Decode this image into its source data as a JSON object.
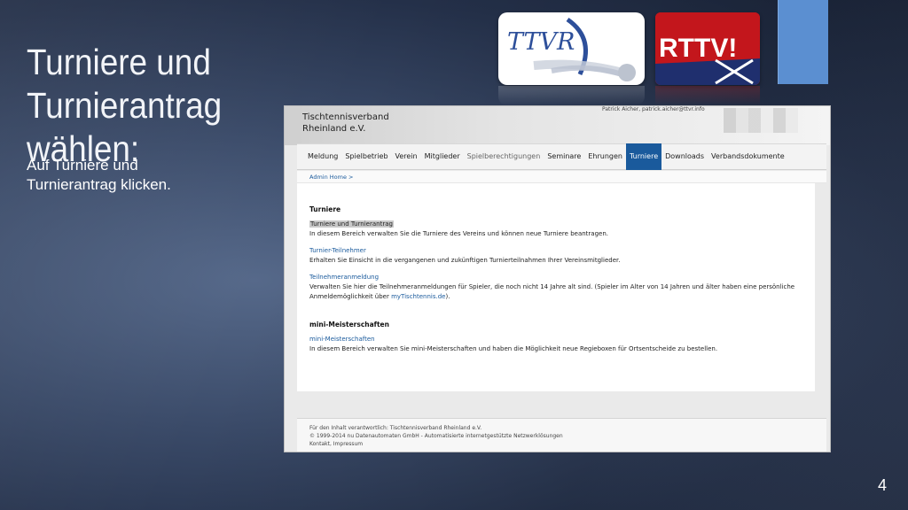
{
  "slide": {
    "title_line1": "Turniere und Turnierantrag",
    "title_line2": "wählen:",
    "body_line1": "Auf Turniere und",
    "body_line2": "Turnierantrag klicken.",
    "page_number": "4",
    "accent_color": "#5b8fd1"
  },
  "logos": {
    "ttvr_text": "TTVR",
    "rttv_text": "RTTV!",
    "ttvr_color": "#2d4f9a",
    "rttv_color": "#c3161c"
  },
  "screenshot": {
    "brand_line1": "Tischtennisverband",
    "brand_line2": "Rheinland e.V.",
    "user_info": "Patrick Aicher, patrick.aicher@ttvr.info",
    "nav": [
      {
        "label": "Meldung",
        "state": "normal"
      },
      {
        "label": "Spielbetrieb",
        "state": "normal"
      },
      {
        "label": "Verein",
        "state": "normal"
      },
      {
        "label": "Mitglieder",
        "state": "normal"
      },
      {
        "label": "Spielberechtigungen",
        "state": "muted"
      },
      {
        "label": "Seminare",
        "state": "normal"
      },
      {
        "label": "Ehrungen",
        "state": "normal"
      },
      {
        "label": "Turniere",
        "state": "active"
      },
      {
        "label": "Downloads",
        "state": "normal"
      },
      {
        "label": "Verbandsdokumente",
        "state": "normal"
      }
    ],
    "breadcrumb": "Admin Home >",
    "section1_title": "Turniere",
    "items": [
      {
        "link": "Turniere und Turnierantrag",
        "desc": "In diesem Bereich verwalten Sie die Turniere des Vereins und können neue Turniere beantragen."
      },
      {
        "link": "Turnier-Teilnehmer",
        "desc": "Erhalten Sie Einsicht in die vergangenen und zukünftigen Turnierteilnahmen Ihrer Vereinsmitglieder."
      },
      {
        "link": "Teilnehmeranmeldung",
        "desc": "Verwalten Sie hier die Teilnehmeranmeldungen für Spieler, die noch nicht 14 Jahre alt sind. (Spieler im Alter von 14 Jahren und älter haben eine persönliche Anmeldemöglichkeit über",
        "desc_link": "myTischtennis.de",
        "desc_end": ")."
      }
    ],
    "section2_title": "mini-Meisterschaften",
    "mini_link": "mini-Meisterschaften",
    "mini_desc": "In diesem Bereich verwalten Sie mini-Meisterschaften und haben die Möglichkeit neue Regieboxen für Ortsentscheide zu bestellen.",
    "footer": {
      "line1": "Für den Inhalt verantwortlich: Tischtennisverband Rheinland e.V.",
      "line2": "© 1999-2014 nu Datenautomaten GmbH - Automatisierte internetgestützte Netzwerklösungen",
      "line3": "Kontakt, Impressum"
    }
  }
}
